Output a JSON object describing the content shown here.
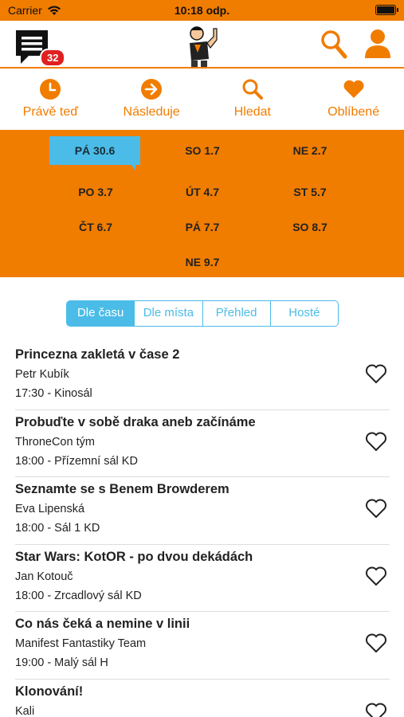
{
  "status": {
    "carrier": "Carrier",
    "time": "10:18 odp."
  },
  "header": {
    "messages_count": "32"
  },
  "nav": [
    {
      "label": "Právě teď",
      "icon": "clock-icon"
    },
    {
      "label": "Následuje",
      "icon": "arrow-right-icon"
    },
    {
      "label": "Hledat",
      "icon": "search-icon"
    },
    {
      "label": "Oblíbené",
      "icon": "heart-icon"
    }
  ],
  "days": [
    "PÁ 30.6",
    "SO 1.7",
    "NE 2.7",
    "PO 3.7",
    "ÚT 4.7",
    "ST 5.7",
    "ČT 6.7",
    "PÁ 7.7",
    "SO 8.7",
    "NE 9.7"
  ],
  "selected_day": "PÁ 30.6",
  "segments": [
    "Dle času",
    "Dle místa",
    "Přehled",
    "Hosté"
  ],
  "selected_segment": "Dle času",
  "events": [
    {
      "title": "Princezna zakletá v čase 2",
      "author": "Petr Kubík",
      "where": "17:30 - Kinosál"
    },
    {
      "title": "Probuďte v sobě draka aneb začínáme",
      "author": "ThroneCon tým",
      "where": "18:00 - Přízemní sál KD"
    },
    {
      "title": "Seznamte se s Benem Browderem",
      "author": "Eva Lipenská",
      "where": "18:00 - Sál 1 KD"
    },
    {
      "title": "Star Wars: KotOR - po dvou dekádách",
      "author": "Jan Kotouč",
      "where": "18:00 - Zrcadlový sál KD"
    },
    {
      "title": "Co nás čeká a nemine v linii",
      "author": "Manifest Fantastiky Team",
      "where": "19:00 - Malý sál H"
    },
    {
      "title": "Klonování!",
      "author": "Kali",
      "where": ""
    }
  ],
  "colors": {
    "brand": "#f07c00",
    "accent": "#4bbce8",
    "badge": "#e02020"
  }
}
